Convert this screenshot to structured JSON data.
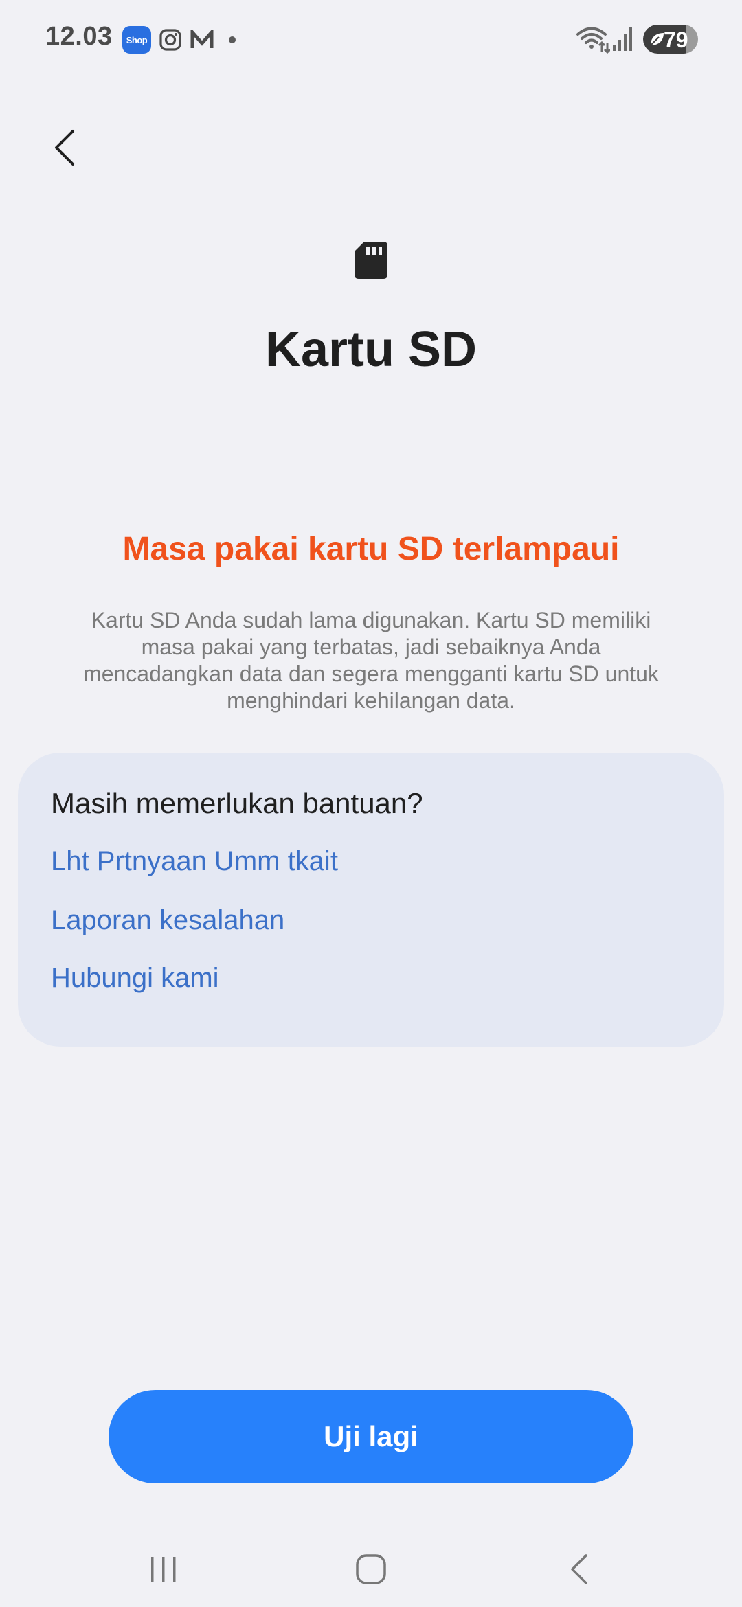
{
  "status_bar": {
    "time": "12.03",
    "notification_icons": [
      "shop-icon",
      "instagram-icon",
      "medium-icon",
      "dot-icon"
    ],
    "shop_label": "Shop",
    "battery_level": "79",
    "battery_fraction": 0.79
  },
  "header": {
    "back_icon": "chevron-left-icon",
    "icon": "sd-card-icon",
    "title": "Kartu SD"
  },
  "warning": {
    "title": "Masa pakai kartu SD terlampaui",
    "description": "Kartu SD Anda sudah lama digunakan. Kartu SD memiliki masa pakai yang terbatas, jadi sebaiknya Anda mencadangkan data dan segera mengganti kartu SD untuk menghindari kehilangan data."
  },
  "help": {
    "heading": "Masih memerlukan bantuan?",
    "links": [
      "Lht Prtnyaan Umm tkait",
      "Laporan kesalahan",
      "Hubungi kami"
    ]
  },
  "actions": {
    "retry_label": "Uji lagi"
  },
  "nav_bar": {
    "icons": [
      "recents-icon",
      "home-icon",
      "back-icon"
    ]
  },
  "colors": {
    "background": "#f1f1f5",
    "warning": "#f0521c",
    "link": "#3b70c8",
    "primary_button": "#2781fb",
    "card": "#e4e8f3"
  }
}
